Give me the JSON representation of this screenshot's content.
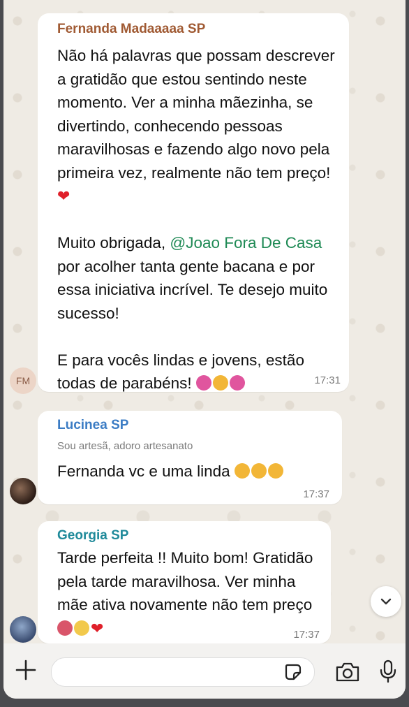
{
  "messages": [
    {
      "sender": "Fernanda Madaaaaa SP",
      "text_p1": "Não há palavras que possam descrever a gratidão que estou sentindo neste momento. Ver a minha mãezinha, se divertindo, conhecendo pessoas maravilhosas e fazendo algo novo pela primeira vez, realmente não tem preço! ",
      "text_p2a": "Muito obrigada, ",
      "mention": "@Joao Fora De Casa",
      "text_p2b": " por acolher tanta gente bacana e por essa iniciativa incrível. Te desejo muito sucesso!",
      "text_p3": "E para vocês lindas e jovens, estão todas de parabéns! ",
      "time": "17:31",
      "avatar_initials": "FM"
    },
    {
      "sender": "Lucinea SP",
      "subtitle": "Sou artesã, adoro artesanato",
      "text": "Fernanda vc e uma linda ",
      "time": "17:37"
    },
    {
      "sender": "Georgia SP",
      "text": "Tarde perfeita !! Muito bom! Gratidão pela tarde maravilhosa. Ver minha mãe ativa novamente não tem preço ",
      "time": "17:37"
    }
  ],
  "icons": {
    "scroll_down": "chevron-down-icon",
    "attach": "plus-icon",
    "sticker": "sticker-icon",
    "camera": "camera-icon",
    "mic": "microphone-icon"
  },
  "colors": {
    "sender1": "#a05a33",
    "sender2": "#3b7cc4",
    "sender3": "#1f8a9a",
    "mention": "#1f8a55",
    "chat_bg": "#efebe4"
  }
}
